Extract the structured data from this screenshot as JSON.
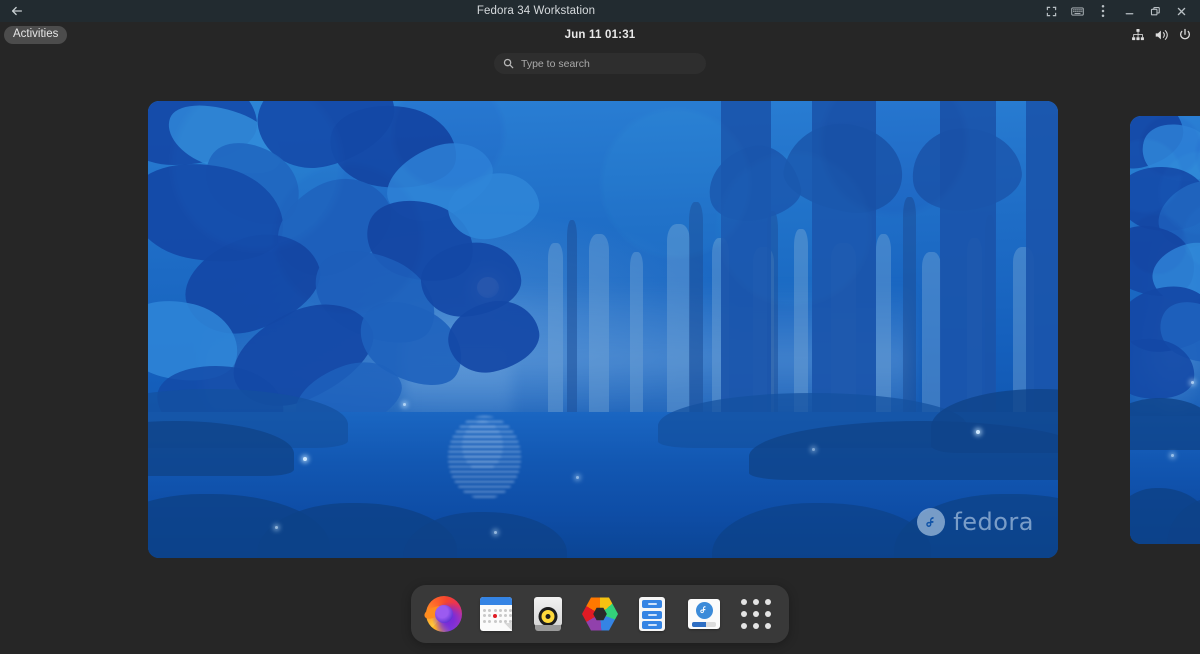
{
  "window": {
    "title": "Fedora 34 Workstation",
    "back_icon": "back-arrow-icon",
    "controls": [
      {
        "name": "fullscreen-button",
        "icon": "fullscreen-icon"
      },
      {
        "name": "keyboard-button",
        "icon": "keyboard-icon"
      },
      {
        "name": "menu-button",
        "icon": "vertical-dots-icon"
      },
      {
        "name": "minimize-button",
        "icon": "minimize-icon"
      },
      {
        "name": "restore-button",
        "icon": "restore-icon"
      },
      {
        "name": "close-button",
        "icon": "close-icon"
      }
    ]
  },
  "topbar": {
    "activities_label": "Activities",
    "clock": "Jun 11  01:31",
    "clock_date": "Jun 11",
    "clock_time": "01:31",
    "tray": [
      {
        "name": "network-wired-icon",
        "label": "Wired Network"
      },
      {
        "name": "volume-icon",
        "label": "Volume"
      },
      {
        "name": "power-icon",
        "label": "Power"
      }
    ]
  },
  "overview": {
    "search": {
      "placeholder": "Type to search",
      "value": "",
      "icon": "search-icon"
    },
    "workspaces": [
      {
        "name": "workspace-thumbnail-1",
        "active": true,
        "wallpaper": "Fedora 34 default blue forest night"
      },
      {
        "name": "workspace-thumbnail-2",
        "active": false,
        "wallpaper": "Fedora 34 default blue forest night"
      }
    ],
    "wallpaper_watermark": "fedora"
  },
  "dock": {
    "items": [
      {
        "name": "dock-item-firefox",
        "label": "Firefox",
        "icon": "firefox-icon"
      },
      {
        "name": "dock-item-calendar",
        "label": "Calendar",
        "icon": "calendar-icon"
      },
      {
        "name": "dock-item-rhythmbox",
        "label": "Rhythmbox",
        "icon": "rhythmbox-icon"
      },
      {
        "name": "dock-item-photos",
        "label": "Photos",
        "icon": "photos-icon"
      },
      {
        "name": "dock-item-files",
        "label": "Files",
        "icon": "files-icon"
      },
      {
        "name": "dock-item-software",
        "label": "Software",
        "icon": "software-icon"
      },
      {
        "name": "dock-item-show-apps",
        "label": "Show Applications",
        "icon": "app-grid-icon"
      }
    ]
  },
  "colors": {
    "titlebar_bg": "#222b30",
    "desktop_bg": "#262626",
    "dock_bg": "#393939",
    "activities_bg": "#4c4c4c",
    "search_bg": "#2e2e2e",
    "accent_blue": "#3584e4",
    "wallpaper_blue": "#1560bd"
  }
}
